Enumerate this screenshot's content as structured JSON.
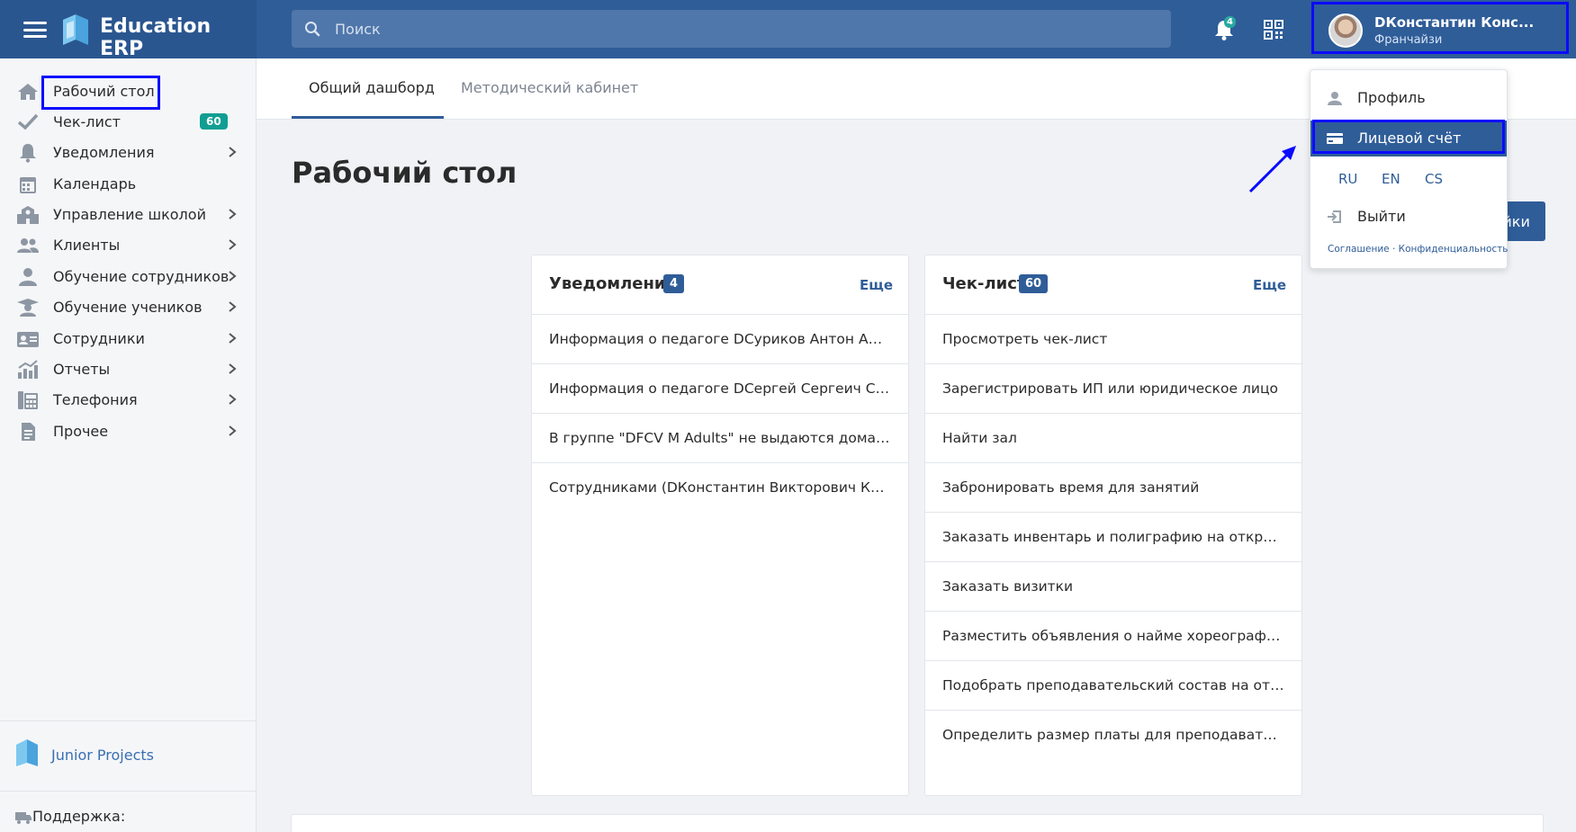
{
  "app": {
    "brand": "Education ERP"
  },
  "search": {
    "placeholder": "Поиск"
  },
  "notifications": {
    "badge": "4"
  },
  "user": {
    "name": "DКонстантин Конс...",
    "role": "Франчайзи"
  },
  "sidebar": {
    "items": [
      {
        "label": "Рабочий стол",
        "icon": "home-icon"
      },
      {
        "label": "Чек-лист",
        "icon": "check-icon",
        "badge": "60"
      },
      {
        "label": "Уведомления",
        "icon": "bell-icon"
      },
      {
        "label": "Календарь",
        "icon": "calendar-icon"
      },
      {
        "label": "Управление школой",
        "icon": "school-icon"
      },
      {
        "label": "Клиенты",
        "icon": "users-icon"
      },
      {
        "label": "Обучение сотрудников",
        "icon": "user-tie-icon"
      },
      {
        "label": "Обучение учеников",
        "icon": "graduate-icon"
      },
      {
        "label": "Сотрудники",
        "icon": "id-card-icon"
      },
      {
        "label": "Отчеты",
        "icon": "chart-icon"
      },
      {
        "label": "Телефония",
        "icon": "phone-icon"
      },
      {
        "label": "Прочее",
        "icon": "file-icon"
      }
    ],
    "footer_project": "Junior Projects",
    "support": "Поддержка:"
  },
  "tabs": [
    {
      "label": "Общий дашборд"
    },
    {
      "label": "Методический кабинет"
    }
  ],
  "page": {
    "title": "Рабочий стол",
    "settings_label": "Настройки"
  },
  "cards": {
    "notifications": {
      "title": "Уведомления",
      "badge": "4",
      "more": "Еще",
      "rows": [
        "Информация о педагоге DСуриков Антон Антонович",
        "Информация о педагоге DСергей Сергеич Сергеев",
        "В группе \"DFCV M Adults\" не выдаются домашние задания",
        "Сотрудниками (DКонстантин Викторович Константинов)"
      ]
    },
    "checklist": {
      "title": "Чек-лист",
      "badge": "60",
      "more": "Еще",
      "rows": [
        "Просмотреть чек-лист",
        "Зарегистрировать ИП или юридическое лицо",
        "Найти зал",
        "Забронировать время для занятий",
        "Заказать инвентарь и полиграфию на открытие",
        "Заказать визитки",
        "Разместить объявления о найме хореографов.",
        "Подобрать преподавательский состав на открытие",
        "Определить размер платы для преподавателей"
      ]
    }
  },
  "dropdown": {
    "profile": "Профиль",
    "account": "Лицевой счёт",
    "langs": [
      "RU",
      "EN",
      "CS"
    ],
    "logout": "Выйти",
    "agreement": "Соглашение",
    "separator": " · ",
    "privacy": "Конфиденциальность"
  },
  "colors": {
    "primary": "#2f5d98",
    "teal": "#109e93",
    "highlight": "#0a0aff"
  }
}
